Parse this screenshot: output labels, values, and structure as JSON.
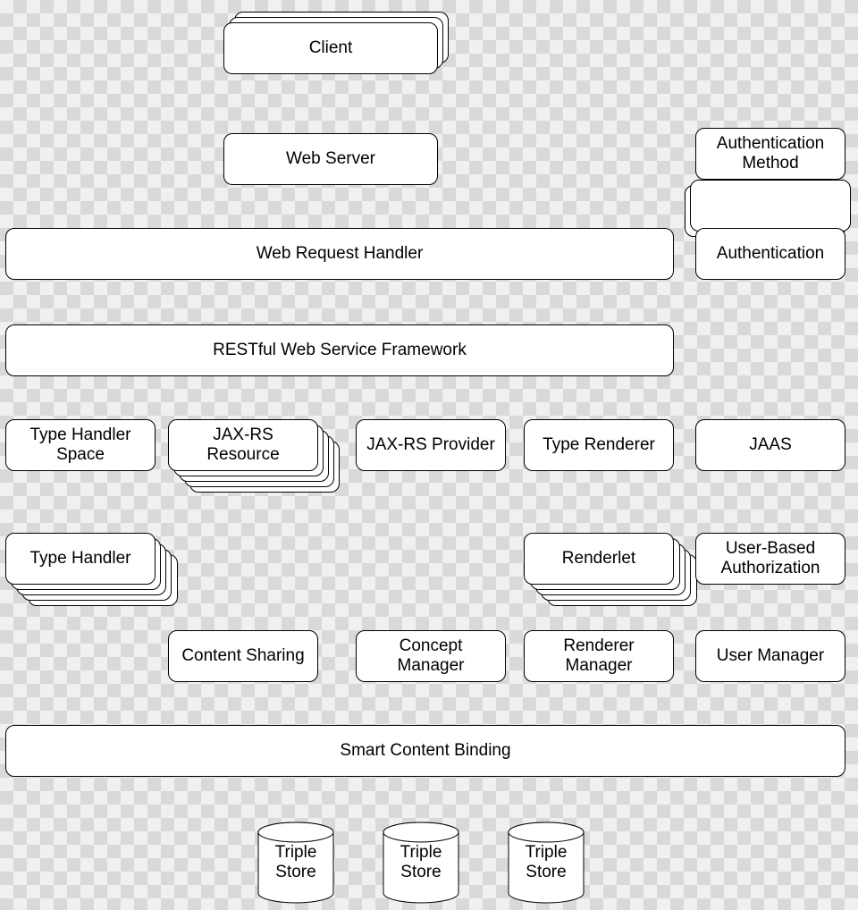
{
  "nodes": {
    "client": "Client",
    "web_server": "Web Server",
    "auth_method": "Authentication Method",
    "web_request_handler": "Web Request Handler",
    "authentication": "Authentication",
    "restful": "RESTful Web Service Framework",
    "type_handler_space": "Type Handler Space",
    "jaxrs_resource": "JAX-RS Resource",
    "jaxrs_provider": "JAX-RS Provider",
    "type_renderer": "Type Renderer",
    "jaas": "JAAS",
    "type_handler": "Type Handler",
    "renderlet": "Renderlet",
    "user_auth": "User-Based Authorization",
    "content_sharing": "Content Sharing",
    "concept_manager": "Concept Manager",
    "renderer_manager": "Renderer Manager",
    "user_manager": "User Manager",
    "smart_content_binding": "Smart Content Binding",
    "triple_store": "Triple Store"
  }
}
